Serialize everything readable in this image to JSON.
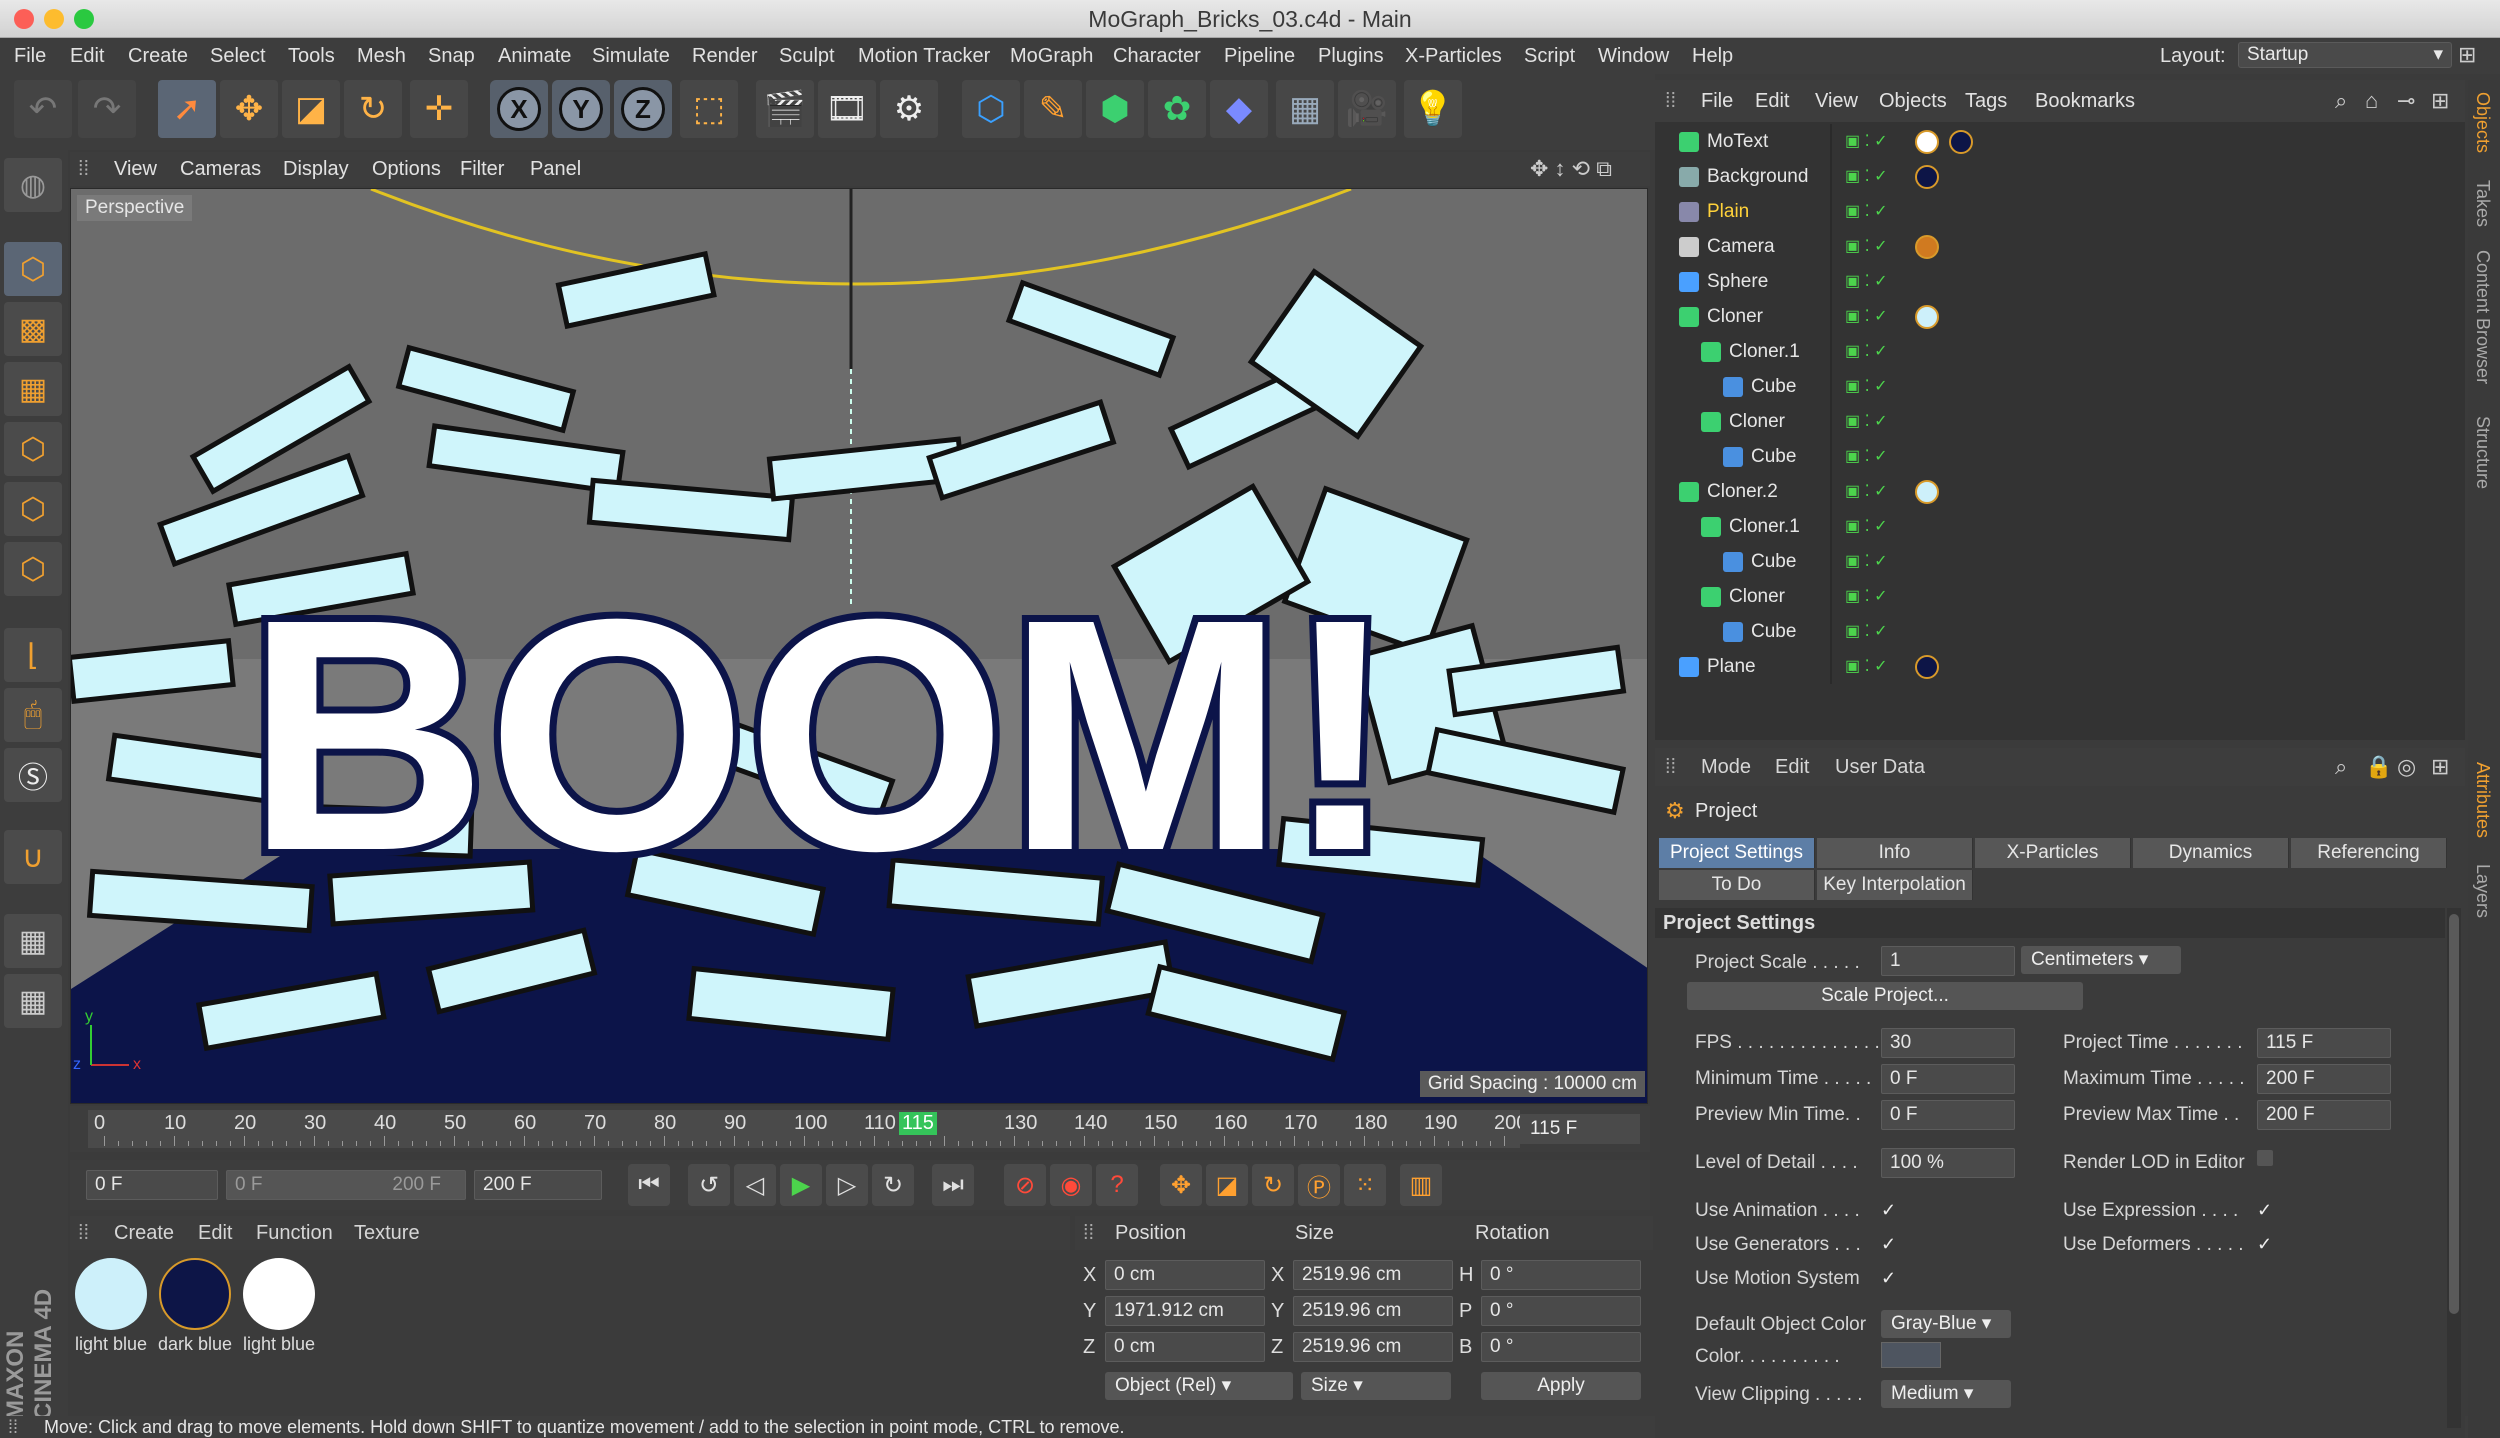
{
  "window": {
    "title": "MoGraph_Bricks_03.c4d - Main"
  },
  "menubar": {
    "items": [
      "File",
      "Edit",
      "Create",
      "Select",
      "Tools",
      "Mesh",
      "Snap",
      "Animate",
      "Simulate",
      "Render",
      "Sculpt",
      "Motion Tracker",
      "MoGraph",
      "Character",
      "Pipeline",
      "Plugins",
      "X-Particles",
      "Script",
      "Window",
      "Help"
    ],
    "layout_label": "Layout:",
    "layout_value": "Startup"
  },
  "toolbar": {
    "axis_x": "X",
    "axis_y": "Y",
    "axis_z": "Z",
    "icons": [
      "undo-icon",
      "redo-icon",
      "select-tool-icon",
      "move-tool-icon",
      "scale-tool-icon",
      "rotate-tool-icon",
      "live-select-icon",
      "x-axis-icon",
      "y-axis-icon",
      "z-axis-icon",
      "coordinate-system-icon",
      "render-view-icon",
      "render-picture-viewer-icon",
      "render-settings-icon",
      "cube-icon",
      "pen-icon",
      "subdivision-icon",
      "cloner-icon",
      "deformer-icon",
      "floor-icon",
      "camera-icon",
      "light-icon"
    ]
  },
  "viewport": {
    "menu": [
      "View",
      "Cameras",
      "Display",
      "Options",
      "Filter",
      "Panel"
    ],
    "label": "Perspective",
    "grid_spacing": "Grid Spacing : 10000 cm",
    "scene_text": "BOOM!",
    "axis_x": "x",
    "axis_y": "y",
    "axis_z": "z"
  },
  "timeline": {
    "ticks": [
      "0",
      "10",
      "20",
      "30",
      "40",
      "50",
      "60",
      "70",
      "80",
      "90",
      "100",
      "110",
      "115",
      "130",
      "140",
      "150",
      "160",
      "170",
      "180",
      "190",
      "200"
    ],
    "current": "115 F",
    "current_frame": 115,
    "max_frame": 200
  },
  "transport": {
    "start": "0 F",
    "range_start": "0 F",
    "range_end": "200 F",
    "end": "200 F"
  },
  "materials": {
    "menu": [
      "Create",
      "Edit",
      "Function",
      "Texture"
    ],
    "items": [
      {
        "name": "light blue",
        "color": "#cdf0fa"
      },
      {
        "name": "dark blue",
        "color": "#0d1547"
      },
      {
        "name": "light blue",
        "color": "#ffffff"
      }
    ]
  },
  "coordinates": {
    "headers": [
      "Position",
      "Size",
      "Rotation"
    ],
    "rows": [
      {
        "axis": "X",
        "pos": "0 cm",
        "size_axis": "X",
        "size": "2519.96 cm",
        "rot_axis": "H",
        "rot": "0 °"
      },
      {
        "axis": "Y",
        "pos": "1971.912 cm",
        "size_axis": "Y",
        "size": "2519.96 cm",
        "rot_axis": "P",
        "rot": "0 °"
      },
      {
        "axis": "Z",
        "pos": "0 cm",
        "size_axis": "Z",
        "size": "2519.96 cm",
        "rot_axis": "B",
        "rot": "0 °"
      }
    ],
    "mode": "Object (Rel)",
    "size_mode": "Size",
    "apply": "Apply"
  },
  "objects": {
    "menu": [
      "File",
      "Edit",
      "View",
      "Objects",
      "Tags",
      "Bookmarks"
    ],
    "items": [
      {
        "name": "MoText",
        "highlight": false
      },
      {
        "name": "Background",
        "highlight": false
      },
      {
        "name": "Plain",
        "highlight": true
      },
      {
        "name": "Camera",
        "highlight": false
      },
      {
        "name": "Sphere",
        "highlight": false
      },
      {
        "name": "Cloner",
        "highlight": false
      },
      {
        "name": "Cloner.1",
        "highlight": false
      },
      {
        "name": "Cube",
        "highlight": false
      },
      {
        "name": "Cloner",
        "highlight": false
      },
      {
        "name": "Cube",
        "highlight": false
      },
      {
        "name": "Cloner.2",
        "highlight": false
      },
      {
        "name": "Cloner.1",
        "highlight": false
      },
      {
        "name": "Cube",
        "highlight": false
      },
      {
        "name": "Cloner",
        "highlight": false
      },
      {
        "name": "Cube",
        "highlight": false
      },
      {
        "name": "Plane",
        "highlight": false
      }
    ]
  },
  "sidetabs": [
    "Objects",
    "Takes",
    "Content Browser",
    "Structure",
    "Attributes",
    "Layers"
  ],
  "attributes": {
    "menu": [
      "Mode",
      "Edit",
      "User Data"
    ],
    "header": "Project",
    "tabs_row1": [
      "Project Settings",
      "Info",
      "X-Particles",
      "Dynamics",
      "Referencing"
    ],
    "tabs_row2": [
      "To Do",
      "Key Interpolation"
    ],
    "section": "Project Settings",
    "project_scale_label": "Project Scale . . . . .",
    "project_scale": "1",
    "scale_unit": "Centimeters",
    "scale_button": "Scale Project...",
    "fps_label": "FPS . . . . . . . . . . . . . .",
    "fps": "30",
    "project_time_label": "Project Time . . . . . . .",
    "project_time": "115 F",
    "min_time_label": "Minimum Time . . . . .",
    "min_time": "0 F",
    "max_time_label": "Maximum Time . . . . .",
    "max_time": "200 F",
    "prev_min_label": "Preview Min Time. .",
    "prev_min": "0 F",
    "prev_max_label": "Preview Max Time . .",
    "prev_max": "200 F",
    "lod_label": "Level of Detail . . . .",
    "lod": "100 %",
    "render_lod_label": "Render LOD in Editor",
    "use_anim": "Use Animation . . . .",
    "use_expr": "Use Expression . . . .",
    "use_gen": "Use Generators . . .",
    "use_def": "Use Deformers . . . . .",
    "use_motion": "Use Motion System",
    "def_color_label": "Default Object Color",
    "def_color": "Gray-Blue",
    "color_label": "Color. . . . . . . . . .",
    "view_clip_label": "View Clipping . . . . .",
    "view_clip": "Medium"
  },
  "status": "Move: Click and drag to move elements. Hold down SHIFT to quantize movement / add to the selection in point mode, CTRL to remove.",
  "brand": "MAXON CINEMA 4D"
}
